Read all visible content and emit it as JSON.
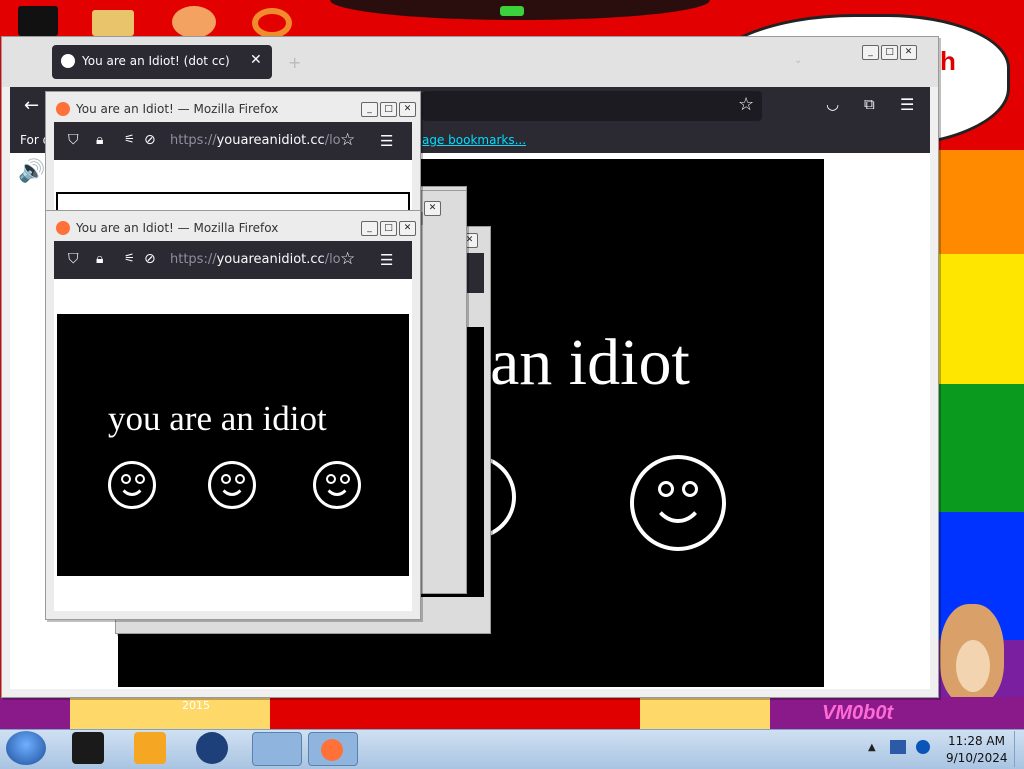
{
  "main_window": {
    "tab_title": "You are an Idiot! (dot cc)",
    "bookmarks_link": "age bookmarks...",
    "bookmarks_left": "For q",
    "page_text": "an idiot"
  },
  "popup1": {
    "title": "You are an Idiot! — Mozilla Firefox",
    "url_prefix": "https://",
    "url_main": "youareanidiot.cc",
    "url_suffix": "/lol."
  },
  "popup2": {
    "title": "You are an Idiot! — Mozilla Firefox",
    "url_prefix": "https://",
    "url_main": "youareanidiot.cc",
    "url_suffix": "/lol.",
    "page_text": "you are an idiot"
  },
  "desktop": {
    "partial_red_text": "h",
    "wall_year": "2015",
    "wall_tag": "VM0b0t"
  },
  "taskbar": {
    "time": "11:28 AM",
    "date": "9/10/2024"
  },
  "colors": {
    "firefox_toolbar": "#2b2a33",
    "taskbar": "#b9d1ea",
    "desktop_red": "#e30000"
  }
}
